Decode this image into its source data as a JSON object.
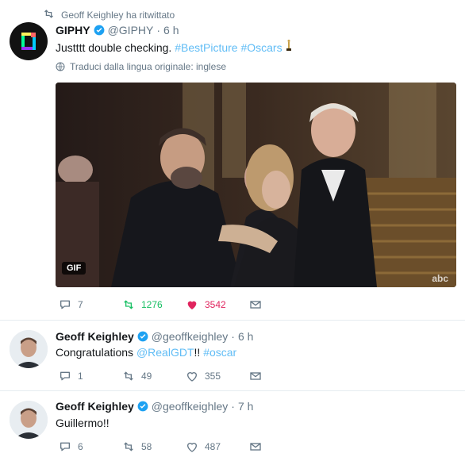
{
  "retweet_context": "Geoff Keighley ha ritwittato",
  "tweets": [
    {
      "name": "GIPHY",
      "handle": "@GIPHY",
      "dot": "·",
      "time": "6 h",
      "text_main": "Justttt double checking.",
      "hashtags": "#BestPicture #Oscars",
      "translate_label": "Traduci dalla lingua originale: inglese",
      "media_badge": "GIF",
      "media_watermark": "abc",
      "replies": "7",
      "retweets": "1276",
      "likes": "3542"
    },
    {
      "name": "Geoff Keighley",
      "handle": "@geoffkeighley",
      "dot": "·",
      "time": "6 h",
      "text_main": "Congratulations",
      "mention": "@RealGDT",
      "after_mention": "!!",
      "hashtag": "#oscar",
      "replies": "1",
      "retweets": "49",
      "likes": "355"
    },
    {
      "name": "Geoff Keighley",
      "handle": "@geoffkeighley",
      "dot": "·",
      "time": "7 h",
      "text_main": "Guillermo!!",
      "replies": "6",
      "retweets": "58",
      "likes": "487"
    }
  ],
  "colors": {
    "accent": "#1da1f2",
    "retweet_green": "#17bf63",
    "like_red": "#e0245e",
    "muted": "#657786"
  }
}
